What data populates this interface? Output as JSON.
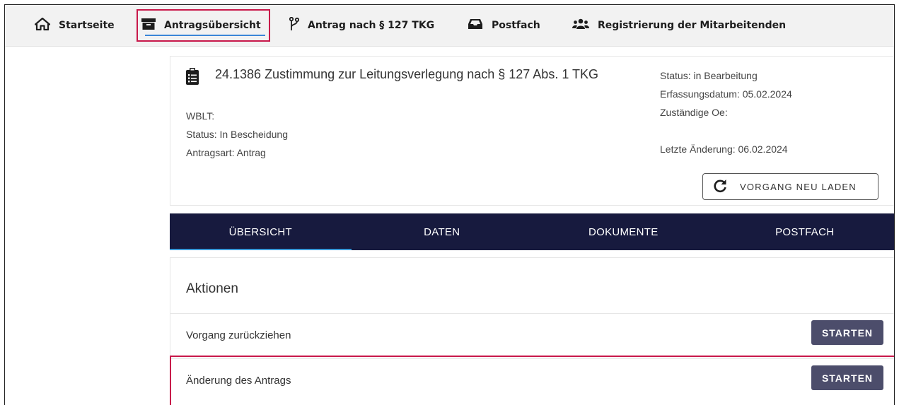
{
  "nav": {
    "items": [
      {
        "label": "Startseite",
        "icon": "home-icon"
      },
      {
        "label": "Antragsübersicht",
        "icon": "archive-icon",
        "active": true
      },
      {
        "label": "Antrag nach § 127 TKG",
        "icon": "branch-icon"
      },
      {
        "label": "Postfach",
        "icon": "inbox-icon"
      },
      {
        "label": "Registrierung der Mitarbeitenden",
        "icon": "users-icon"
      }
    ]
  },
  "case": {
    "title": "24.1386 Zustimmung zur Leitungsverlegung nach § 127 Abs. 1 TKG",
    "wblt": "WBLT:",
    "status": "Status: In Bescheidung",
    "antragsart": "Antragsart: Antrag",
    "right_status": "Status: in Bearbeitung",
    "erfassungsdatum": "Erfassungsdatum: 05.02.2024",
    "zustaendige_oe": "Zuständige Oe:",
    "letzte_aenderung": "Letzte Änderung: 06.02.2024",
    "reload_label": "VORGANG NEU LADEN"
  },
  "tabs": [
    {
      "label": "ÜBERSICHT",
      "active": true
    },
    {
      "label": "DATEN",
      "active": false
    },
    {
      "label": "DOKUMENTE",
      "active": false
    },
    {
      "label": "POSTFACH",
      "active": false
    }
  ],
  "actions": {
    "title": "Aktionen",
    "rows": [
      {
        "label": "Vorgang zurückziehen",
        "button": "STARTEN"
      },
      {
        "label": "Änderung des Antrags",
        "button": "STARTEN"
      }
    ]
  },
  "colors": {
    "tab_bar": "#171a3e",
    "tab_active_underline": "#3a9ad9",
    "button": "#4c4d6b",
    "highlight": "#c8184a",
    "nav_underline": "#3a86d8"
  }
}
